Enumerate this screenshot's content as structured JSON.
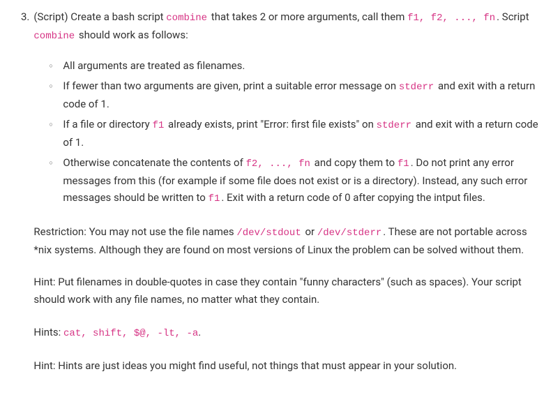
{
  "question": {
    "number": "3.",
    "label": "(Script)",
    "intro_p1_a": " Create a bash script ",
    "intro_p1_code1": "combine",
    "intro_p1_b": " that takes 2 or more arguments, call them ",
    "intro_p1_code2": "f1, f2, ..., fn",
    "intro_p1_c": ". Script ",
    "intro_p1_code3": "combine",
    "intro_p1_d": " should work as follows:",
    "bullets": {
      "b1": "All arguments are treated as filenames.",
      "b2_a": "If fewer than two arguments are given, print a suitable error message on ",
      "b2_code": "stderr",
      "b2_b": " and exit with a return code of 1.",
      "b3_a": "If a file or directory ",
      "b3_code1": "f1",
      "b3_b": " already exists, print \"Error: first file exists\" on ",
      "b3_code2": "stderr",
      "b3_c": " and exit with a return code of 1.",
      "b4_a": "Otherwise concatenate the contents of ",
      "b4_code1": "f2, ..., fn",
      "b4_b": " and copy them to ",
      "b4_code2": "f1",
      "b4_c": ". Do not print any error messages from this (for example if some file does not exist or is a directory). Instead, any such error messages should be written to ",
      "b4_code3": "f1",
      "b4_d": ". Exit with a return code of 0 after copying the intput files."
    },
    "restriction_a": "Restriction: You may not use the file names ",
    "restriction_code1": "/dev/stdout",
    "restriction_b": " or ",
    "restriction_code2": "/dev/stderr",
    "restriction_c": ". These are not portable across *nix systems. Although they are found on most versions of Linux the problem can be solved without them.",
    "hint1": "Hint: Put filenames in double-quotes in case they contain \"funny characters\" (such as spaces). Your script should work with any file names, no matter what they contain.",
    "hint2_a": "Hints: ",
    "hint2_code": "cat, shift, $@, -lt, -a",
    "hint2_b": ".",
    "hint3": "Hint: Hints are just ideas you might find useful, not things that must appear in your solution."
  }
}
